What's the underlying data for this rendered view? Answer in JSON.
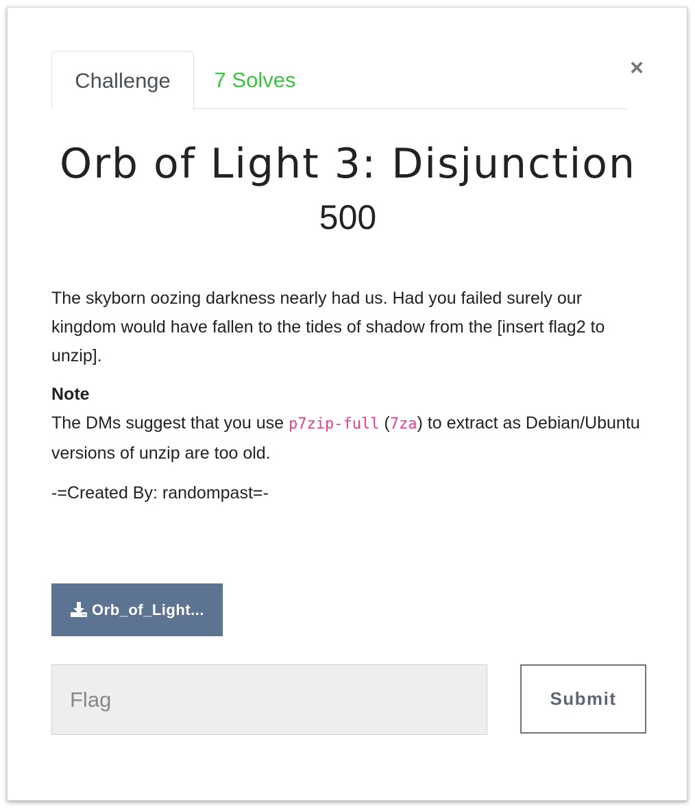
{
  "tabs": [
    {
      "label": "Challenge",
      "active": true
    },
    {
      "label": "7 Solves",
      "active": false
    }
  ],
  "close_glyph": "×",
  "challenge": {
    "title": "Orb of Light 3: Disjunction",
    "value": "500"
  },
  "description": {
    "intro": "The skyborn oozing darkness nearly had us. Had you failed surely our kingdom would have fallen to the tides of shadow from the [insert flag2 to unzip].",
    "note_heading": "Note",
    "note_prefix": "The DMs suggest that you use ",
    "note_code1": "p7zip-full",
    "note_paren_open": " (",
    "note_code2": "7za",
    "note_suffix": ") to extract as Debian/Ubuntu versions of unzip are too old.",
    "credit": "-=Created By: randompast=-"
  },
  "file": {
    "label": "Orb_of_Light...",
    "icon": "download-icon"
  },
  "flag_input": {
    "placeholder": "Flag",
    "value": ""
  },
  "submit_label": "Submit",
  "colors": {
    "solves_tab": "#3bc440",
    "download_button": "#5c7391",
    "code_text": "#e83e8c"
  }
}
